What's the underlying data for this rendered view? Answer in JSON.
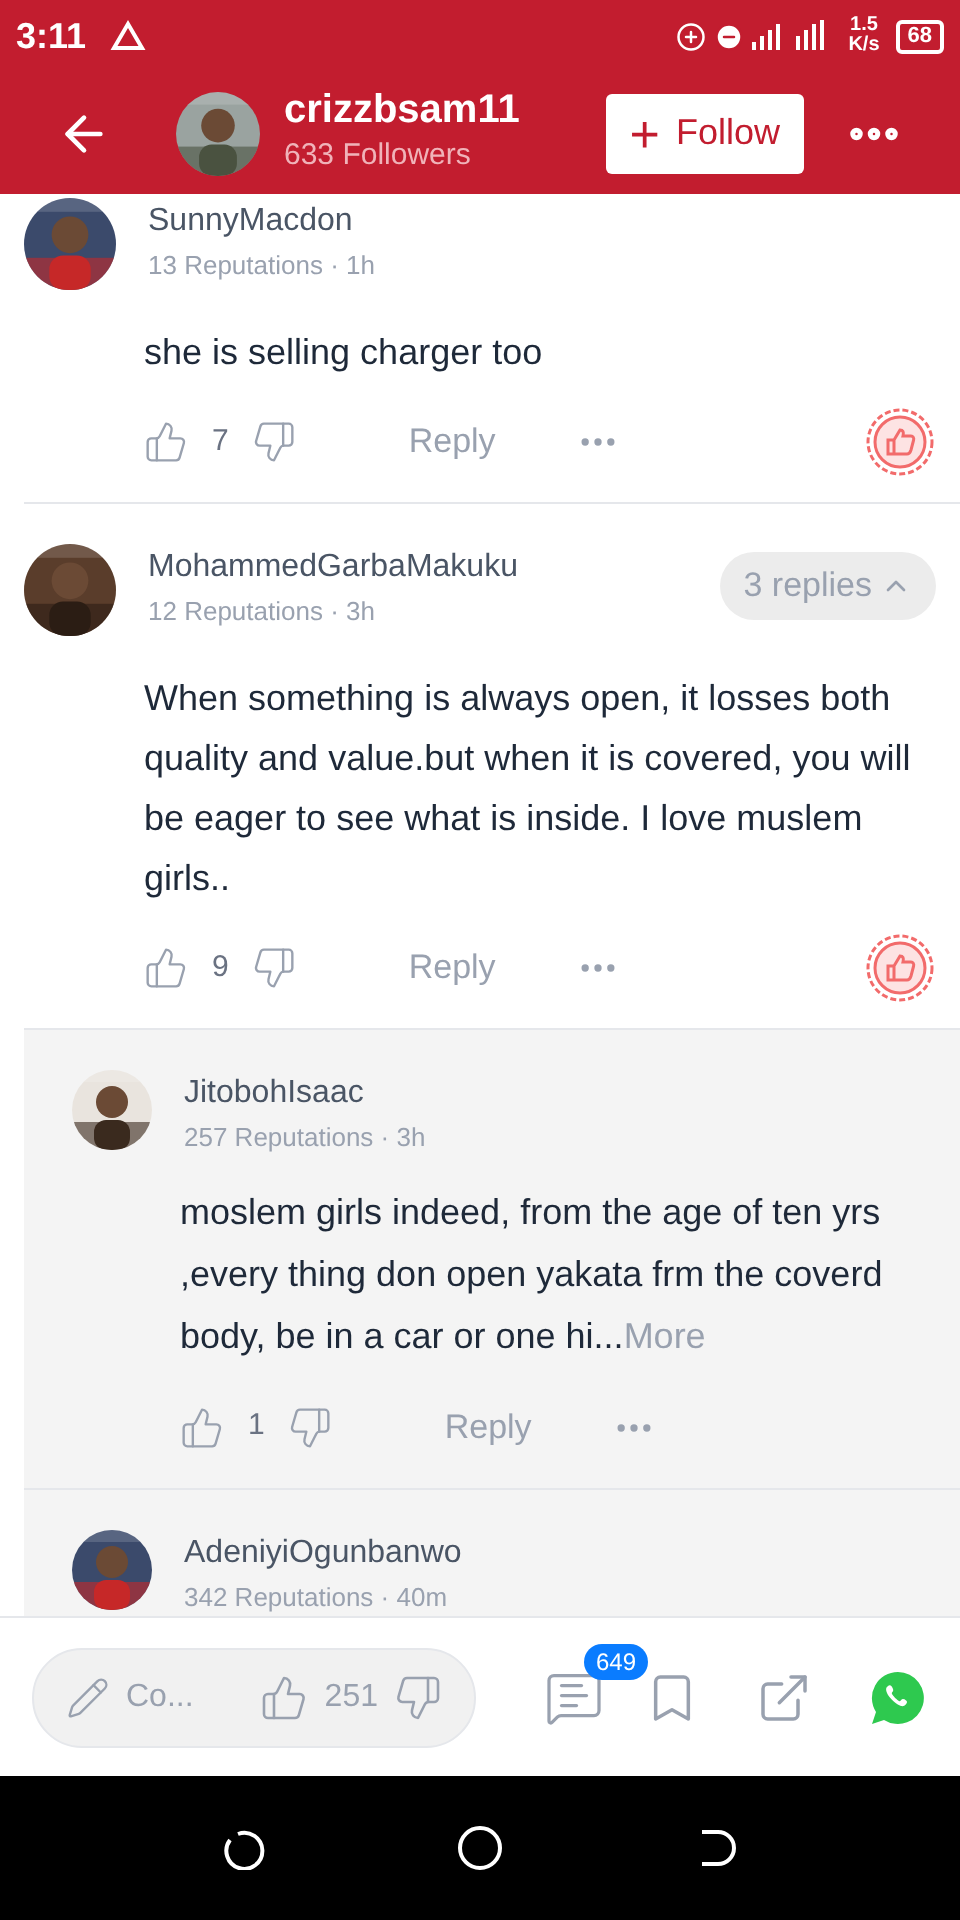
{
  "status_bar": {
    "time": "3:11",
    "speed_value": "1.5",
    "speed_unit": "K/s",
    "battery": "68"
  },
  "header": {
    "username": "crizzbsam11",
    "followers": "633 Followers",
    "follow_button": "Follow",
    "follow_icon": "+"
  },
  "comments": [
    {
      "name": "SunnyMacdon",
      "meta": "13 Reputations · 1h",
      "text": "she is selling charger too",
      "likes": "7",
      "reply": "Reply",
      "award": true
    },
    {
      "name": "MohammedGarbaMakuku",
      "meta": "12 Reputations · 3h",
      "text": "When something is always open, it losses both quality and value.but when it is covered, you will be eager to see what is inside. I love muslem girls..",
      "likes": "9",
      "reply": "Reply",
      "award": true,
      "replies_toggle": "3 replies",
      "expanded": true,
      "children": [
        {
          "name": "JitobohIsaac",
          "meta": "257 Reputations · 3h",
          "text": "moslem girls indeed, from the age of ten yrs ,every thing don open yakata frm the coverd body, be  in a car or one hi...",
          "more": "More",
          "likes": "1",
          "reply": "Reply"
        },
        {
          "name": "AdeniyiOgunbanwo",
          "meta": "342 Reputations · 40m"
        }
      ]
    }
  ],
  "bottom_bar": {
    "comment_placeholder": "Co...",
    "likes": "251",
    "comment_count": "649"
  }
}
